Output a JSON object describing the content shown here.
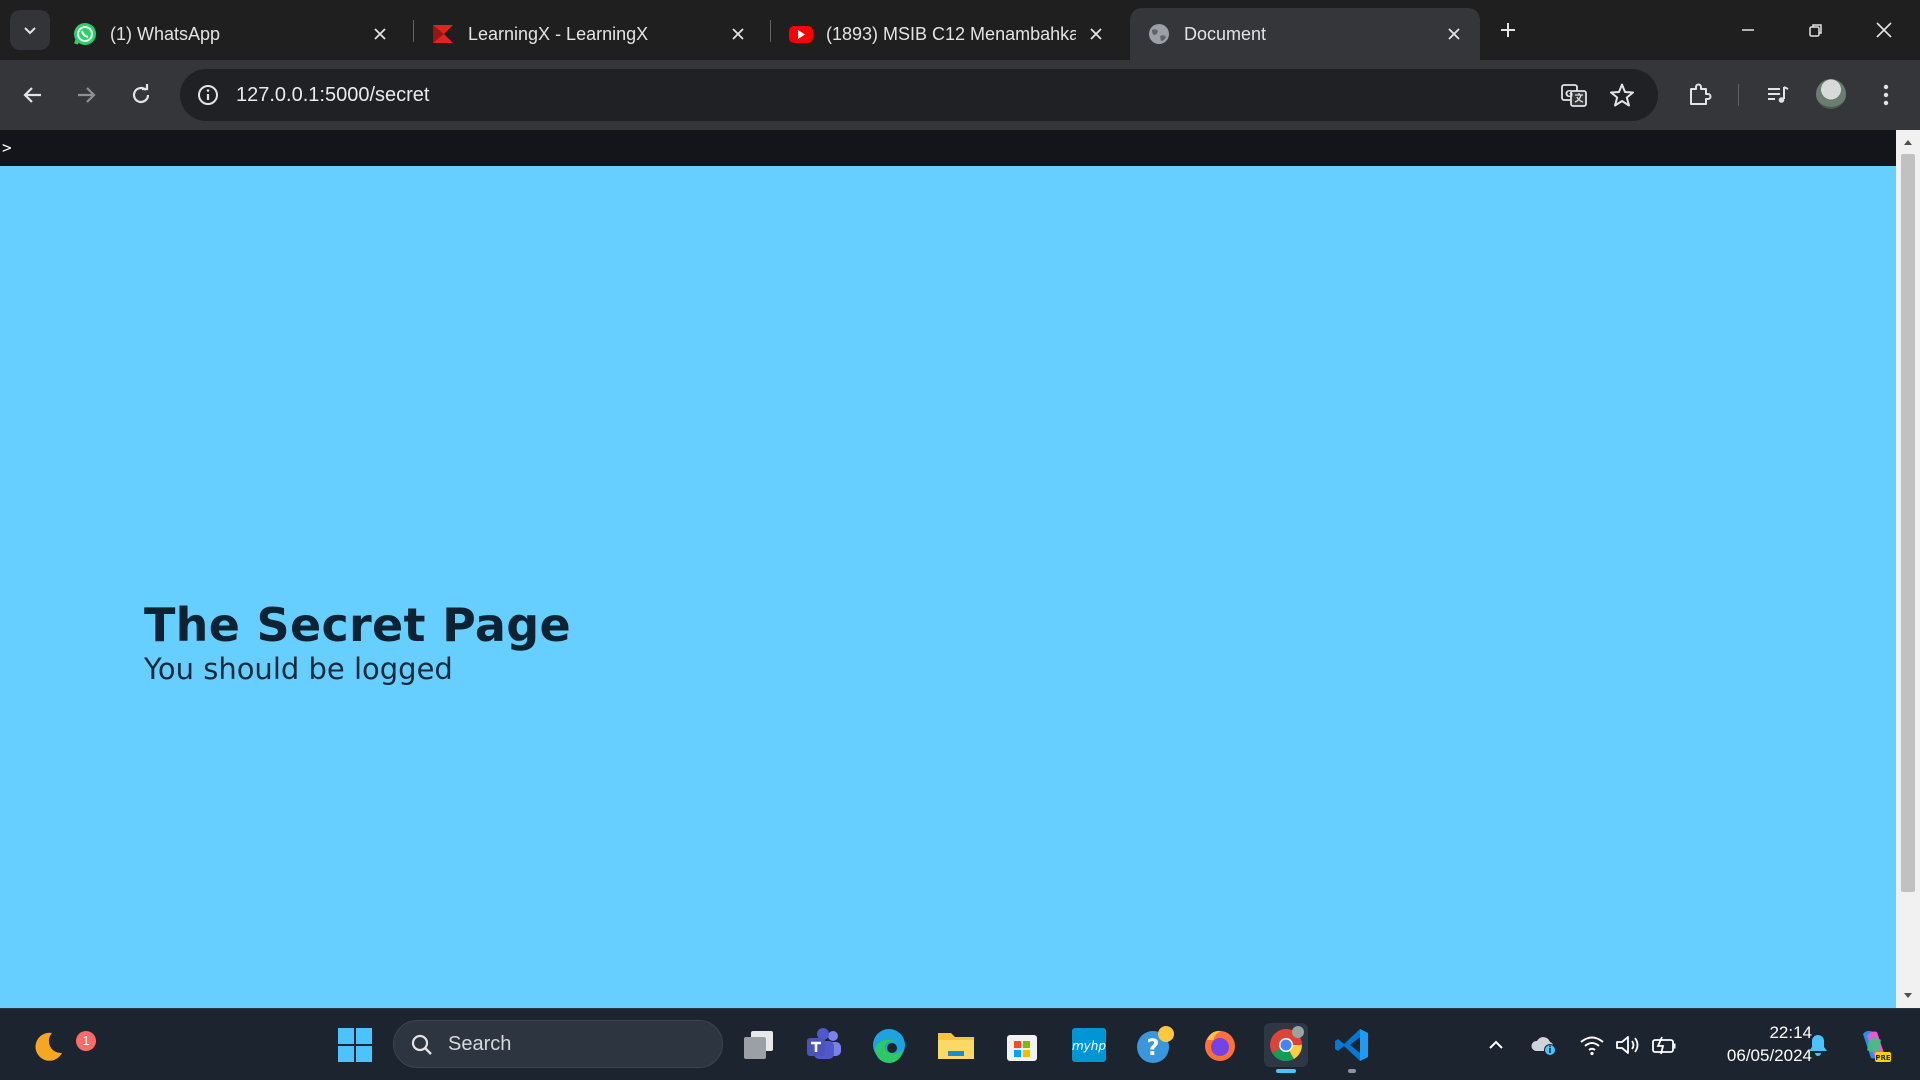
{
  "browser": {
    "tabs": [
      {
        "title": "(1) WhatsApp",
        "icon": "whatsapp-icon"
      },
      {
        "title": "LearningX - LearningX",
        "icon": "learningx-icon"
      },
      {
        "title": "(1893) MSIB C12 Menambahkan",
        "icon": "youtube-icon"
      },
      {
        "title": "Document",
        "icon": "globe-icon",
        "active": true
      }
    ],
    "url_host": "127.0.0.1",
    "url_path": ":5000/secret"
  },
  "page": {
    "devbar_text": ">",
    "heading": "The Secret Page",
    "subtext": "You should be logged",
    "background_color": "#66cfff"
  },
  "taskbar": {
    "search_label": "Search",
    "notification_count": "1",
    "time": "22:14",
    "date": "06/05/2024"
  }
}
